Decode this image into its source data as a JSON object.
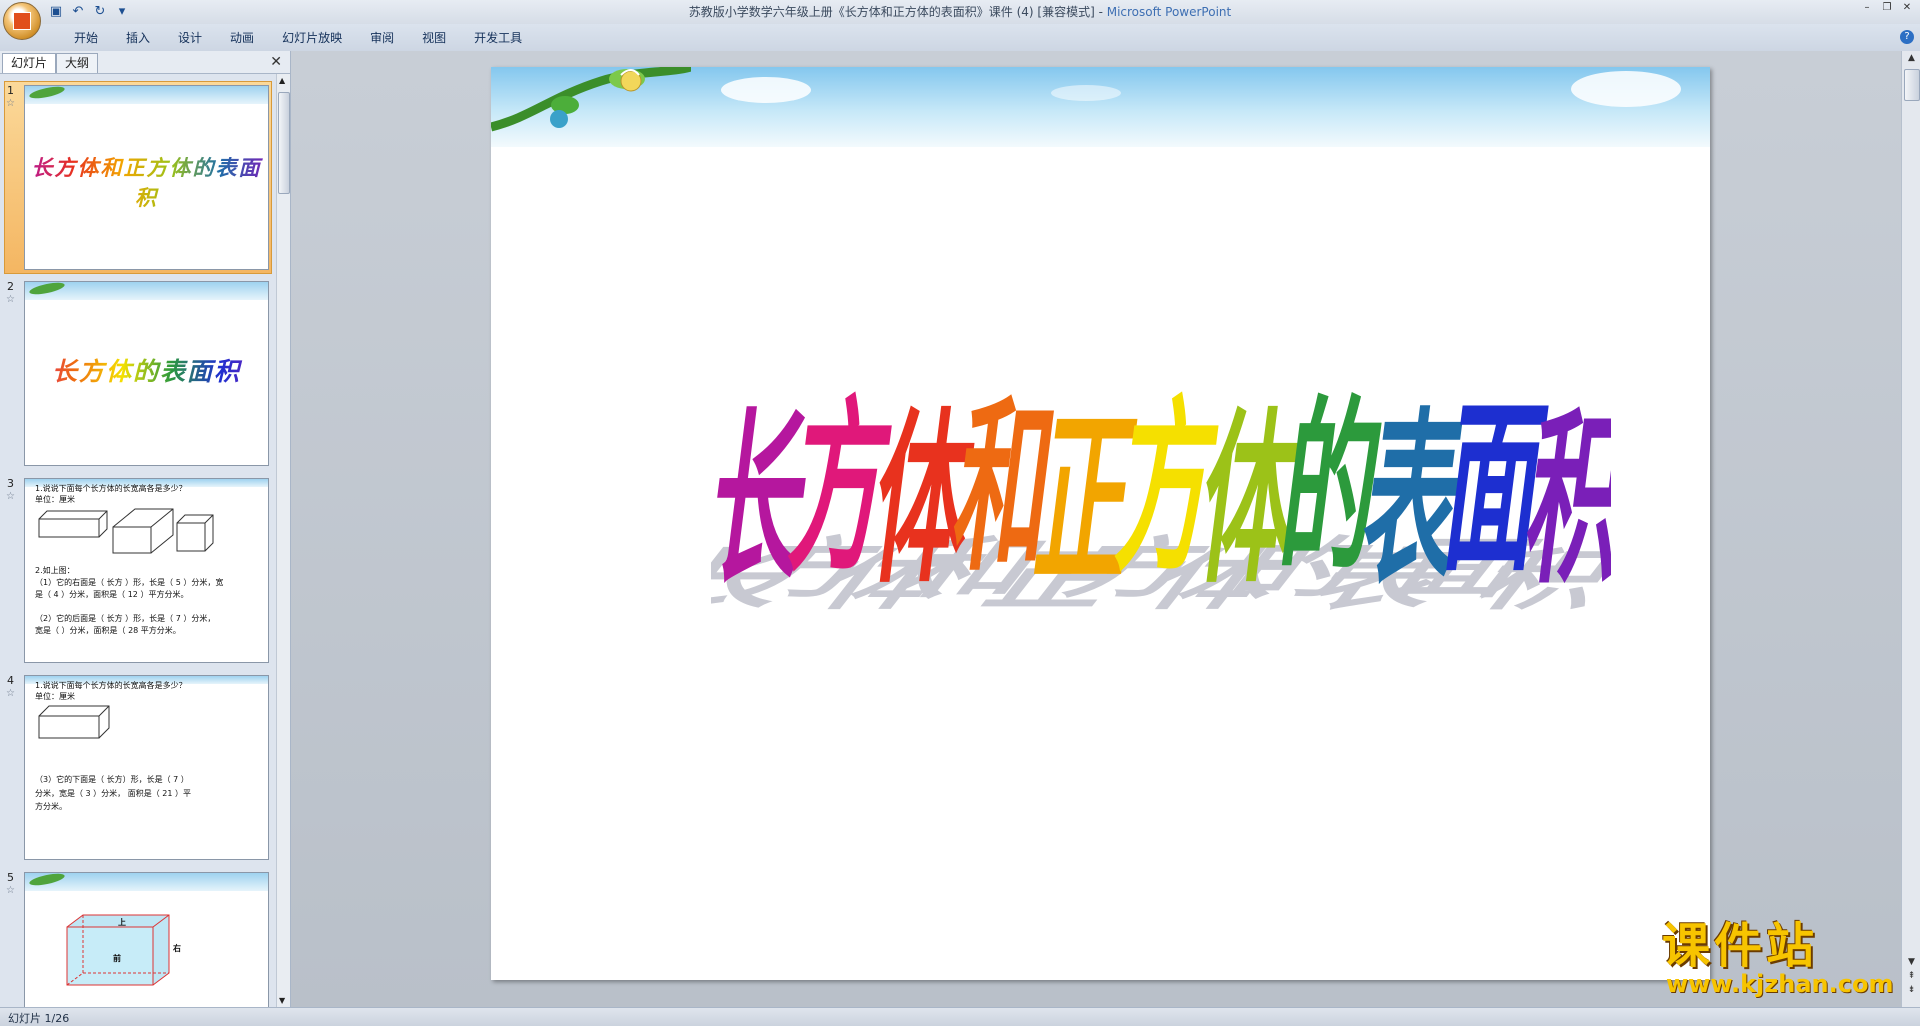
{
  "window": {
    "title": "苏教版小学数学六年级上册《长方体和正方体的表面积》课件 (4) [兼容模式] - ",
    "app_name": "Microsoft PowerPoint"
  },
  "qat": {
    "icons": [
      "save-icon",
      "undo-icon",
      "redo-icon",
      "customize-icon"
    ]
  },
  "ribbon": {
    "tabs": [
      "开始",
      "插入",
      "设计",
      "动画",
      "幻灯片放映",
      "审阅",
      "视图",
      "开发工具"
    ]
  },
  "left_pane": {
    "tabs": [
      "幻灯片",
      "大纲"
    ],
    "slides": [
      {
        "num": "1",
        "title": "长方体和正方体的表面积"
      },
      {
        "num": "2",
        "title": "长方体的表面积"
      },
      {
        "num": "3",
        "lines": [
          "1.说说下面每个长方体的长宽高各是多少？",
          "单位：厘米",
          "2.如上图：",
          "（1）它的右面是（    长方  ）形，长是（ 5 ）分米，宽",
          "是（ 4 ）分米，面积是（   12   ）平方分米。",
          "（2）它的后面是（ 长方 ）形，长是（  7   ）分米，",
          "宽是（     ）分米，面积是（       28  平方分米。"
        ]
      },
      {
        "num": "4",
        "lines": [
          "1.说说下面每个长方体的长宽高各是多少？",
          "单位：厘米",
          "（3）它的下面是（      长方）形，长是（  7   ）",
          "分米，宽是（   3    ）分米， 面积是（   21   ）平",
          "方分米。"
        ]
      },
      {
        "num": "5",
        "labels": [
          "上",
          "前",
          "右"
        ]
      }
    ]
  },
  "slide": {
    "title_chars": [
      "长",
      "方",
      "体",
      "和",
      "正",
      "方",
      "体",
      "的",
      "表",
      "面",
      "积"
    ],
    "title_colors": [
      "#b5179e",
      "#e0187a",
      "#e8321e",
      "#ee6a12",
      "#f2a500",
      "#f5e000",
      "#9cc218",
      "#2c9a3c",
      "#1f6ea8",
      "#1d2fd0",
      "#7a1fb8"
    ]
  },
  "status": {
    "text": "幻灯片 1/26"
  },
  "watermark": {
    "title": "课件站",
    "url": "www.kjzhan.com"
  }
}
